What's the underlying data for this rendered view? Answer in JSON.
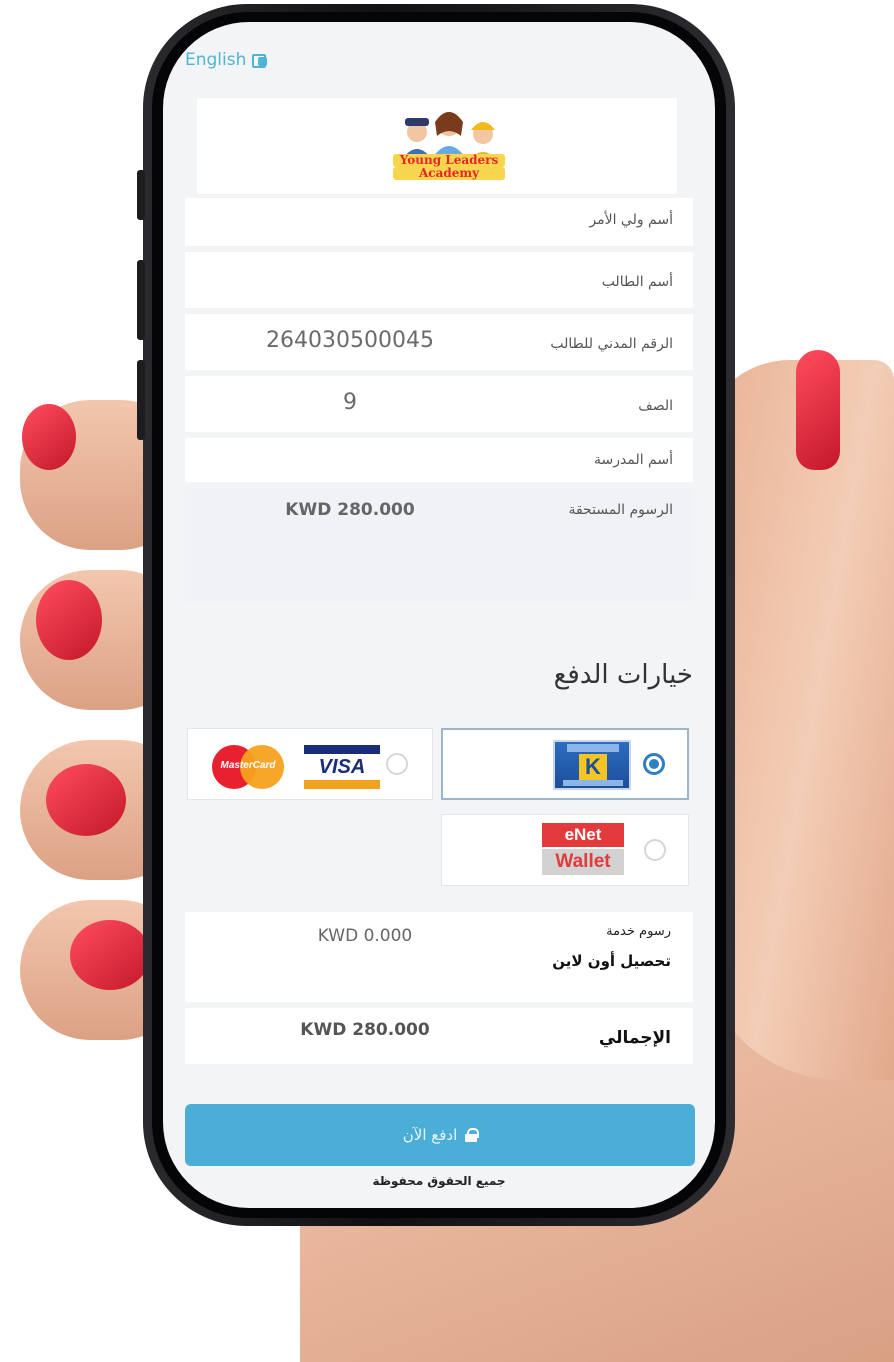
{
  "header": {
    "language_toggle": "English",
    "language_icon": "translate-icon"
  },
  "logo": {
    "line1": "Young Leaders",
    "line2": "Academy"
  },
  "form": {
    "guardian_name_label": "أسم ولي الأمر",
    "guardian_name_value": "",
    "student_name_label": "أسم الطالب",
    "student_name_value": "",
    "civil_id_label": "الرقم المدني للطالب",
    "civil_id_value": "264030500045",
    "grade_label": "الصف",
    "grade_value": "9",
    "school_name_label": "أسم المدرسة",
    "school_name_value": "",
    "fees_due_label": "الرسوم المستحقة",
    "fees_due_value": "KWD 280.000"
  },
  "payment": {
    "title": "خيارات الدفع",
    "selected": "knet",
    "options": {
      "knet": {
        "logo_letter": "K"
      },
      "cards": {
        "visa": "VISA",
        "mastercard": "MasterCard"
      },
      "enet": {
        "line1": "eNet",
        "line2": "Wallet"
      }
    }
  },
  "summary": {
    "service_fee_label": "رسوم خدمة",
    "service_fee_sublabel": "تحصيل أون لاين",
    "service_fee_value": "KWD 0.000",
    "total_label": "الإجمالي",
    "total_value": "KWD 280.000"
  },
  "pay_button": {
    "label": "ادفع الآن",
    "icon": "lock-icon"
  },
  "footer": {
    "text": "جميع الحقوق محفوظة"
  },
  "colors": {
    "accent": "#4aaed6",
    "radio_selected": "#2f7fc1",
    "nail": "#e3263a"
  }
}
